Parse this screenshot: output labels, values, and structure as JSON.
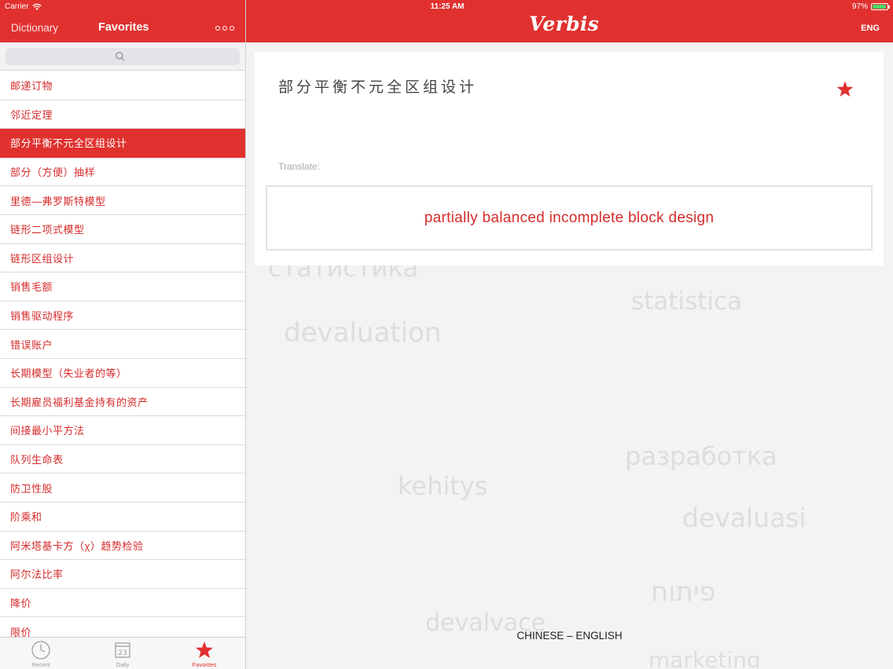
{
  "status_bar": {
    "carrier": "Carrier",
    "time": "11:25 AM",
    "battery": "97%",
    "battery_level": 0.97
  },
  "left_header": {
    "back_label": "Dictionary",
    "title": "Favorites",
    "more_icon": "more-icon"
  },
  "search": {
    "placeholder": "",
    "icon": "search-icon"
  },
  "favorites": [
    "邮递订物",
    "邻近定理",
    "部分平衡不元全区组设计",
    "部分（方便）抽样",
    "里德—弗罗斯特模型",
    "链形二项式模型",
    "链形区组设计",
    "销售毛额",
    "销售驱动程序",
    "错误账户",
    "长期模型（失业者的等）",
    "长期雇员福利基金持有的资产",
    "间接最小平方法",
    "队列生命表",
    "防卫性股",
    "阶乘和",
    "阿米塔基卡方（χ）趋势检验",
    "阿尔法比率",
    "降价",
    "限价"
  ],
  "selected_index": 2,
  "tabs": [
    {
      "label": "Recent",
      "icon": "clock-icon"
    },
    {
      "label": "Daily",
      "icon": "calendar-icon",
      "day": "23"
    },
    {
      "label": "Favorites",
      "icon": "star-icon"
    }
  ],
  "right_header": {
    "app_name": "Verbis",
    "language": "ENG"
  },
  "card": {
    "word": "部分平衡不元全区组设计",
    "translate_label": "Translate:",
    "translation": "partially balanced incomplete block design",
    "favorite_icon": "star-icon"
  },
  "background_words": [
    "статистика",
    "statistica",
    "devaluation",
    "разработка",
    "kehitys",
    "devaluasi",
    "פיתוח",
    "marketing",
    "devalvace"
  ],
  "direction": "CHINESE – ENGLISH",
  "colors": {
    "accent": "#e0312f",
    "list_text": "#d62b2b",
    "background": "#f3f3f5"
  }
}
